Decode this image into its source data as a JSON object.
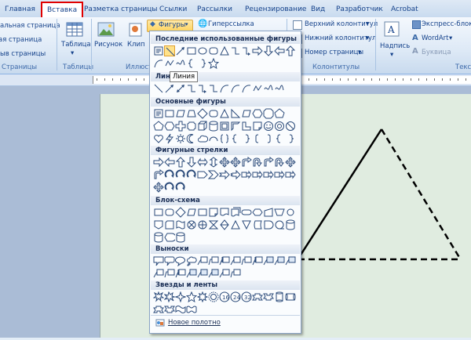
{
  "tabs": [
    {
      "label": "Главная"
    },
    {
      "label": "Вставка"
    },
    {
      "label": "Разметка страницы"
    },
    {
      "label": "Ссылки"
    },
    {
      "label": "Рассылки"
    },
    {
      "label": "Рецензирование"
    },
    {
      "label": "Вид"
    },
    {
      "label": "Разработчик"
    },
    {
      "label": "Acrobat"
    }
  ],
  "ribbon": {
    "pages": {
      "item1": "альная страница",
      "item2": "ая страница",
      "item3": "ыв страницы",
      "group": "Страницы"
    },
    "tables": {
      "button": "Таблица",
      "group": "Таблицы"
    },
    "illustrations": {
      "picture": "Рисунок",
      "clip": "Клип",
      "shapes": "Фигуры",
      "group": "Иллюст"
    },
    "links": {
      "hyperlink": "Гиперссылка"
    },
    "headers": {
      "header": "Верхний колонтитул",
      "footer": "Нижний колонтитул",
      "pagenum": "Номер страницы",
      "group": "Колонтитулы"
    },
    "text": {
      "textbox": "Надпись",
      "quickparts": "Экспресс-блоки",
      "wordart": "WordArt",
      "dropcap": "Буквица",
      "group": "Текс"
    }
  },
  "shapes_menu": {
    "sections": [
      {
        "title": "Последние использованные фигуры"
      },
      {
        "title": "Линии"
      },
      {
        "title": "Основные фигуры"
      },
      {
        "title": "Фигурные стрелки"
      },
      {
        "title": "Блок-схема"
      },
      {
        "title": "Выноски"
      },
      {
        "title": "Звезды и ленты"
      }
    ],
    "tooltip": "Линия",
    "new_canvas": "Новое полотно"
  },
  "colors": {
    "active_tab_border": "#e00000",
    "page_bg": "#e0ece0",
    "ribbon_text": "#15428b"
  }
}
